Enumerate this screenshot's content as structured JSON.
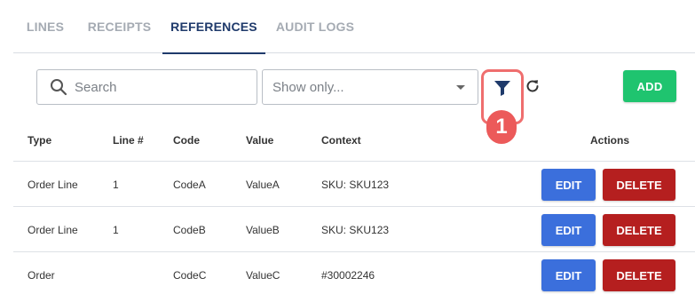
{
  "tabs": [
    {
      "label": "LINES",
      "active": false
    },
    {
      "label": "RECEIPTS",
      "active": false
    },
    {
      "label": "REFERENCES",
      "active": true
    },
    {
      "label": "AUDIT LOGS",
      "active": false
    }
  ],
  "toolbar": {
    "search_placeholder": "Search",
    "select_placeholder": "Show only...",
    "filter_icon": "filter-icon",
    "refresh_icon": "refresh-icon",
    "badge_label": "1",
    "add_label": "ADD"
  },
  "table": {
    "headers": {
      "type": "Type",
      "line": "Line #",
      "code": "Code",
      "value": "Value",
      "context": "Context",
      "actions": "Actions"
    },
    "rows": [
      {
        "type": "Order Line",
        "line": "1",
        "code": "CodeA",
        "value": "ValueA",
        "context": "SKU: SKU123",
        "edit": "EDIT",
        "delete": "DELETE"
      },
      {
        "type": "Order Line",
        "line": "1",
        "code": "CodeB",
        "value": "ValueB",
        "context": "SKU: SKU123",
        "edit": "EDIT",
        "delete": "DELETE"
      },
      {
        "type": "Order",
        "line": "",
        "code": "CodeC",
        "value": "ValueC",
        "context": "#30002246",
        "edit": "EDIT",
        "delete": "DELETE"
      }
    ]
  },
  "colors": {
    "active_tab": "#1f3a6b",
    "add_button": "#1fc46f",
    "edit_button": "#3b6fdc",
    "delete_button": "#b51f1f",
    "highlight": "#ec5a5a"
  }
}
